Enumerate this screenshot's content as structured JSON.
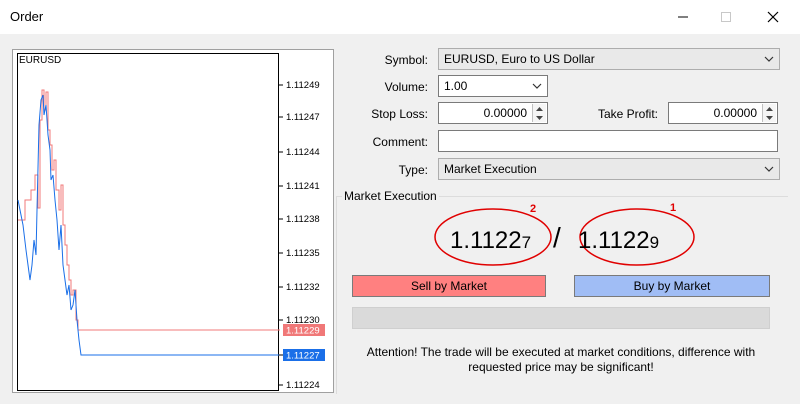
{
  "window": {
    "title": "Order"
  },
  "chart": {
    "symbol": "EURUSD",
    "ticks": [
      "1.11249",
      "1.11247",
      "1.11244",
      "1.11241",
      "1.11238",
      "1.11235",
      "1.11232",
      "1.11230",
      "1.11227",
      "1.11224"
    ],
    "ask_tag": "1.11229",
    "bid_tag": "1.11227",
    "ask_color": "#f07878",
    "bid_color": "#1a6fe8"
  },
  "form": {
    "symbol_label": "Symbol:",
    "symbol_value": "EURUSD, Euro to US Dollar",
    "volume_label": "Volume:",
    "volume_value": "1.00",
    "stoploss_label": "Stop Loss:",
    "stoploss_value": "0.00000",
    "takeprofit_label": "Take Profit:",
    "takeprofit_value": "0.00000",
    "comment_label": "Comment:",
    "comment_value": "",
    "type_label": "Type:",
    "type_value": "Market Execution"
  },
  "execution": {
    "legend": "Market Execution",
    "bid_main": "1.1122",
    "bid_small": "7",
    "ask_main": "1.1122",
    "ask_small": "9",
    "separator": "/",
    "marker_bid": "2",
    "marker_ask": "1",
    "sell_label": "Sell by Market",
    "buy_label": "Buy by Market",
    "sell_color": "#ff8080",
    "buy_color": "#a0bdf5",
    "warning": "Attention! The trade will be executed at market conditions, difference with requested price may be significant!"
  }
}
